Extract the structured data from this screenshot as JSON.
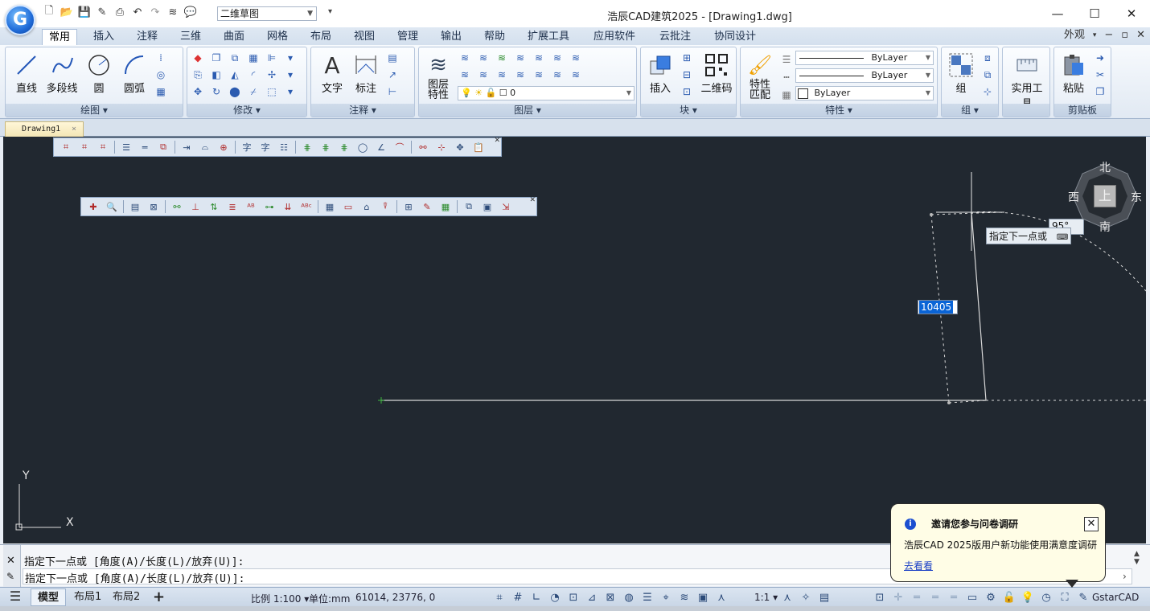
{
  "app": {
    "title": "浩辰CAD建筑2025 - [Drawing1.dwg]",
    "logo_letter": "G",
    "workspace": "二维草图"
  },
  "window_controls": {
    "minimize": "—",
    "maximize": "☐",
    "close": "✕"
  },
  "ribbon_tabs": [
    "常用",
    "插入",
    "注释",
    "三维",
    "曲面",
    "网格",
    "布局",
    "视图",
    "管理",
    "输出",
    "帮助",
    "扩展工具",
    "应用软件",
    "云批注",
    "协同设计"
  ],
  "ribbon_right": {
    "appearance": "外观",
    "mini": "−",
    "restore": "▫",
    "close": "✕"
  },
  "panels": {
    "draw": {
      "title": "绘图 ▾",
      "line": "直线",
      "polyline": "多段线",
      "circle": "圆",
      "arc": "圆弧"
    },
    "modify": {
      "title": "修改 ▾"
    },
    "annotate": {
      "title": "注释 ▾",
      "text": "文字",
      "dim": "标注"
    },
    "layers": {
      "title": "图层 ▾",
      "layer_props": "图层\n特性",
      "current_layer": "0"
    },
    "block": {
      "title": "块 ▾",
      "insert": "插入",
      "qrcode": "二维码"
    },
    "properties": {
      "title": "特性 ▾",
      "match": "特性\n匹配",
      "color": "ByLayer",
      "linetype": "ByLayer",
      "lineweight": "ByLayer"
    },
    "group": {
      "title": "组 ▾",
      "group": "组"
    },
    "utilities": {
      "title": "",
      "label": "实用工具"
    },
    "clipboard": {
      "title": "剪贴板",
      "paste": "粘贴"
    }
  },
  "doc_tab": {
    "name": "Drawing1",
    "close": "×"
  },
  "canvas": {
    "tooltip": "指定下一点或",
    "angle": "95°",
    "dyn_length": "10405",
    "ucs_x": "X",
    "ucs_y": "Y",
    "viewcube": {
      "north": "北",
      "south": "南",
      "east": "东",
      "west": "西",
      "top": "上"
    }
  },
  "command": {
    "history": "指定下一点或 [角度(A)/长度(L)/放弃(U)]:",
    "prompt": "指定下一点或 [角度(A)/长度(L)/放弃(U)]:"
  },
  "notification": {
    "title": "邀请您参与问卷调研",
    "body": "浩辰CAD 2025版用户新功能使用满意度调研",
    "link": "去看看",
    "close": "✕"
  },
  "status": {
    "tabs": [
      "模型",
      "布局1",
      "布局2"
    ],
    "add": "+",
    "scale": "比例 1:100 ▾",
    "units": "单位:mm",
    "coords": "61014, 23776, 0",
    "anno_scale": "1:1 ▾",
    "brand": "GstarCAD"
  },
  "colors": {
    "canvas": "#212830",
    "accent": "#0a64d6",
    "notify_bg": "#fffde6"
  }
}
